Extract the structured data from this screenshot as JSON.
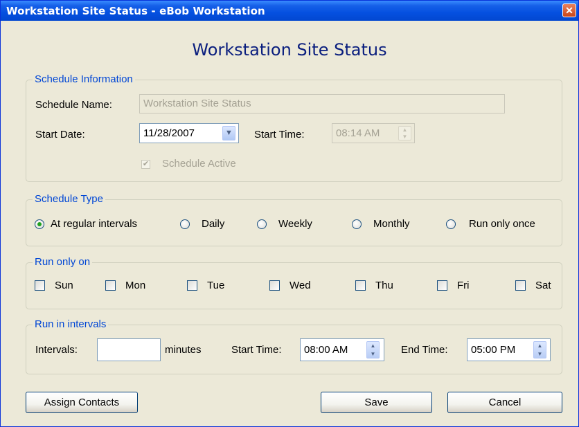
{
  "window": {
    "title": "Workstation Site Status - eBob Workstation",
    "close_glyph": "✕"
  },
  "heading": "Workstation Site Status",
  "schedule_info": {
    "legend": "Schedule Information",
    "name_label": "Schedule Name:",
    "name_value": "Workstation Site Status",
    "start_date_label": "Start Date:",
    "start_date_value": "11/28/2007",
    "start_time_label": "Start Time:",
    "start_time_value": "08:14 AM",
    "active_label": "Schedule Active",
    "active_checked": true,
    "check_glyph": "✔"
  },
  "schedule_type": {
    "legend": "Schedule Type",
    "options": [
      "At regular intervals",
      "Daily",
      "Weekly",
      "Monthly",
      "Run only once"
    ],
    "selected": "At regular intervals"
  },
  "run_only_on": {
    "legend": "Run only on",
    "days": [
      "Sun",
      "Mon",
      "Tue",
      "Wed",
      "Thu",
      "Fri",
      "Sat"
    ]
  },
  "run_in_intervals": {
    "legend": "Run in intervals",
    "intervals_label": "Intervals:",
    "intervals_value": "",
    "minutes_label": "minutes",
    "start_time_label": "Start Time:",
    "start_time_value": "08:00 AM",
    "end_time_label": "End Time:",
    "end_time_value": "05:00 PM"
  },
  "buttons": {
    "assign": "Assign Contacts",
    "save": "Save",
    "cancel": "Cancel"
  },
  "icons": {
    "dropdown": "chevron-down-icon",
    "spin_up": "▲",
    "spin_down": "▼"
  },
  "colors": {
    "title_bar": "#0550E0",
    "heading": "#0A1E7E",
    "legend": "#0046D5",
    "face": "#ECE9D8"
  }
}
